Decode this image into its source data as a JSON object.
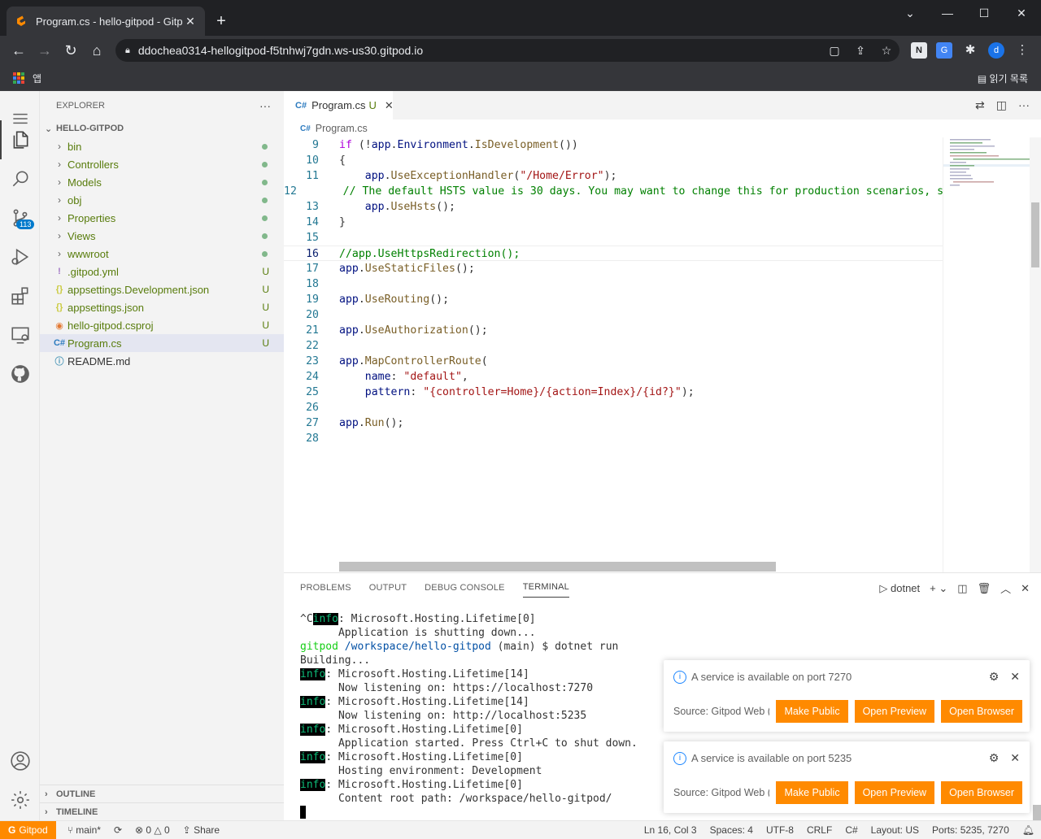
{
  "browser": {
    "tab_title": "Program.cs - hello-gitpod - Gitp",
    "url": "ddochea0314-hellogitpod-f5tnhwj7gdn.ws-us30.gitpod.io",
    "apps_label": "앱",
    "reading_list_label": "읽기 목록",
    "profile_letter": "d"
  },
  "activity": {
    "scm_badge": "113"
  },
  "sidebar": {
    "title": "EXPLORER",
    "more": "···",
    "section": "HELLO-GITPOD",
    "items": [
      {
        "name": "bin",
        "kind": "folder"
      },
      {
        "name": "Controllers",
        "kind": "folder"
      },
      {
        "name": "Models",
        "kind": "folder"
      },
      {
        "name": "obj",
        "kind": "folder"
      },
      {
        "name": "Properties",
        "kind": "folder"
      },
      {
        "name": "Views",
        "kind": "folder"
      },
      {
        "name": "wwwroot",
        "kind": "folder"
      },
      {
        "name": ".gitpod.yml",
        "kind": "file",
        "icon": "!",
        "badge": "U"
      },
      {
        "name": "appsettings.Development.json",
        "kind": "file",
        "icon": "{}",
        "badge": "U"
      },
      {
        "name": "appsettings.json",
        "kind": "file",
        "icon": "{}",
        "badge": "U"
      },
      {
        "name": "hello-gitpod.csproj",
        "kind": "file",
        "icon": "rss",
        "badge": "U"
      },
      {
        "name": "Program.cs",
        "kind": "file",
        "icon": "C#",
        "badge": "U"
      },
      {
        "name": "README.md",
        "kind": "file",
        "icon": "i"
      }
    ],
    "outline": "OUTLINE",
    "timeline": "TIMELINE"
  },
  "editor": {
    "tab_label": "Program.cs",
    "tab_badge": "U",
    "breadcrumb": "Program.cs",
    "lines": [
      {
        "n": "9",
        "html": "<span class='kw'>if</span> (!<span class='pr'>app</span>.<span class='pr'>Environment</span>.<span class='fn'>IsDevelopment</span>())"
      },
      {
        "n": "10",
        "html": "{"
      },
      {
        "n": "11",
        "html": "    <span class='pr'>app</span>.<span class='fn'>UseExceptionHandler</span>(<span class='st'>\"/Home/Error\"</span>);"
      },
      {
        "n": "12",
        "html": "    <span class='cm'>// The default HSTS value is 30 days. You may want to change this for production scenarios, s</span>"
      },
      {
        "n": "13",
        "html": "    <span class='pr'>app</span>.<span class='fn'>UseHsts</span>();"
      },
      {
        "n": "14",
        "html": "}"
      },
      {
        "n": "15",
        "html": ""
      },
      {
        "n": "16",
        "html": "<span class='cm'>//app.UseHttpsRedirection();</span>",
        "current": true
      },
      {
        "n": "17",
        "html": "<span class='pr'>app</span>.<span class='fn'>UseStaticFiles</span>();"
      },
      {
        "n": "18",
        "html": ""
      },
      {
        "n": "19",
        "html": "<span class='pr'>app</span>.<span class='fn'>UseRouting</span>();"
      },
      {
        "n": "20",
        "html": ""
      },
      {
        "n": "21",
        "html": "<span class='pr'>app</span>.<span class='fn'>UseAuthorization</span>();"
      },
      {
        "n": "22",
        "html": ""
      },
      {
        "n": "23",
        "html": "<span class='pr'>app</span>.<span class='fn'>MapControllerRoute</span>("
      },
      {
        "n": "24",
        "html": "    <span class='pr'>name</span>: <span class='st'>\"default\"</span>,"
      },
      {
        "n": "25",
        "html": "    <span class='pr'>pattern</span>: <span class='st'>\"{controller=Home}/{action=Index}/{id?}\"</span>);"
      },
      {
        "n": "26",
        "html": ""
      },
      {
        "n": "27",
        "html": "<span class='pr'>app</span>.<span class='fn'>Run</span>();"
      },
      {
        "n": "28",
        "html": ""
      }
    ]
  },
  "panel": {
    "tabs": [
      "PROBLEMS",
      "OUTPUT",
      "DEBUG CONSOLE",
      "TERMINAL"
    ],
    "active_tab": 3,
    "terminal_name": "dotnet",
    "terminal_lines": [
      {
        "pre": "^C",
        "info": "info",
        "rest": ": Microsoft.Hosting.Lifetime[0]"
      },
      {
        "text": "      Application is shutting down..."
      },
      {
        "prompt_user": "gitpod",
        "prompt_path": "/workspace/hello-gitpod",
        "prompt_rest": " (main) $ dotnet run"
      },
      {
        "text": "Building..."
      },
      {
        "info": "info",
        "rest": ": Microsoft.Hosting.Lifetime[14]"
      },
      {
        "text": "      Now listening on: https://localhost:7270"
      },
      {
        "info": "info",
        "rest": ": Microsoft.Hosting.Lifetime[14]"
      },
      {
        "text": "      Now listening on: http://localhost:5235"
      },
      {
        "info": "info",
        "rest": ": Microsoft.Hosting.Lifetime[0]"
      },
      {
        "text": "      Application started. Press Ctrl+C to shut down."
      },
      {
        "info": "info",
        "rest": ": Microsoft.Hosting.Lifetime[0]"
      },
      {
        "text": "      Hosting environment: Development"
      },
      {
        "info": "info",
        "rest": ": Microsoft.Hosting.Lifetime[0]"
      },
      {
        "text": "      Content root path: /workspace/hello-gitpod/"
      }
    ]
  },
  "notifications": [
    {
      "message": "A service is available on port 7270",
      "source": "Source: Gitpod Web (E...",
      "buttons": [
        "Make Public",
        "Open Preview",
        "Open Browser"
      ]
    },
    {
      "message": "A service is available on port 5235",
      "source": "Source: Gitpod Web (E...",
      "buttons": [
        "Make Public",
        "Open Preview",
        "Open Browser"
      ]
    }
  ],
  "status": {
    "gitpod": "Gitpod",
    "branch": "main*",
    "errors": "0",
    "warnings": "0",
    "share": "Share",
    "position": "Ln 16, Col 3",
    "spaces": "Spaces: 4",
    "encoding": "UTF-8",
    "eol": "CRLF",
    "language": "C#",
    "layout": "Layout: US",
    "ports": "Ports: 5235, 7270"
  },
  "colors": {
    "gitpod_orange": "#ff8a00",
    "accent_blue": "#007acc",
    "untracked_green": "#587c0c"
  }
}
